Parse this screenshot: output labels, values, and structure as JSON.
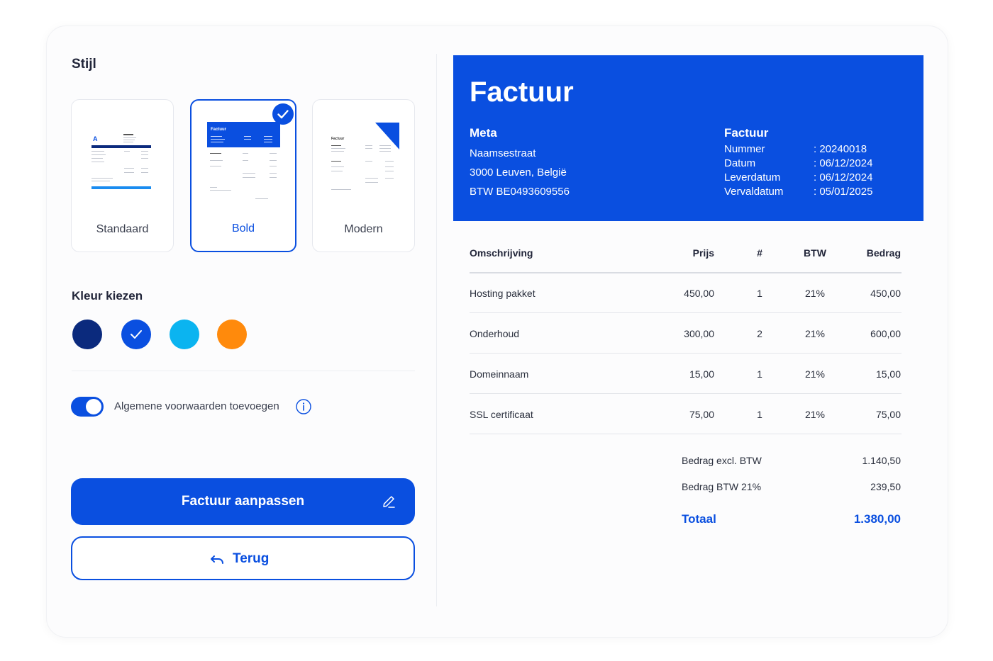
{
  "left": {
    "style_heading": "Stijl",
    "templates": [
      {
        "label": "Standaard",
        "selected": false
      },
      {
        "label": "Bold",
        "selected": true
      },
      {
        "label": "Modern",
        "selected": false
      }
    ],
    "color_heading": "Kleur kiezen",
    "colors": [
      {
        "hex": "#0b2a7d",
        "selected": false
      },
      {
        "hex": "#0a4fe0",
        "selected": true
      },
      {
        "hex": "#0bb4f0",
        "selected": false
      },
      {
        "hex": "#ff8a0c",
        "selected": false
      }
    ],
    "terms_toggle": {
      "label": "Algemene voorwaarden toevoegen",
      "on": true
    },
    "primary_button": "Factuur aanpassen",
    "back_button": "Terug"
  },
  "thumbnails": {
    "standaard": {
      "logo_letter": "A"
    },
    "bold": {
      "header_word": "Factuur"
    },
    "modern": {
      "header_word": "Factuur"
    }
  },
  "invoice": {
    "title": "Factuur",
    "meta_heading": "Meta",
    "meta_lines": [
      "Naamsestraat",
      "3000 Leuven, België",
      "BTW BE0493609556"
    ],
    "factuur_heading": "Factuur",
    "fields": [
      {
        "key": "Nummer",
        "value": ": 20240018"
      },
      {
        "key": "Datum",
        "value": ": 06/12/2024"
      },
      {
        "key": "Leverdatum",
        "value": ": 06/12/2024"
      },
      {
        "key": "Vervaldatum",
        "value": ": 05/01/2025"
      }
    ],
    "columns": {
      "desc": "Omschrijving",
      "price": "Prijs",
      "qty": "#",
      "vat": "BTW",
      "amount": "Bedrag"
    },
    "rows": [
      {
        "desc": "Hosting pakket",
        "price": "450,00",
        "qty": "1",
        "vat": "21%",
        "amount": "450,00"
      },
      {
        "desc": "Onderhoud",
        "price": "300,00",
        "qty": "2",
        "vat": "21%",
        "amount": "600,00"
      },
      {
        "desc": "Domeinnaam",
        "price": "15,00",
        "qty": "1",
        "vat": "21%",
        "amount": "15,00"
      },
      {
        "desc": "SSL certificaat",
        "price": "75,00",
        "qty": "1",
        "vat": "21%",
        "amount": "75,00"
      }
    ],
    "subtotal_label": "Bedrag excl. BTW",
    "subtotal_value": "1.140,50",
    "vat_label": "Bedrag BTW 21%",
    "vat_value": "239,50",
    "total_label": "Totaal",
    "total_value": "1.380,00"
  }
}
